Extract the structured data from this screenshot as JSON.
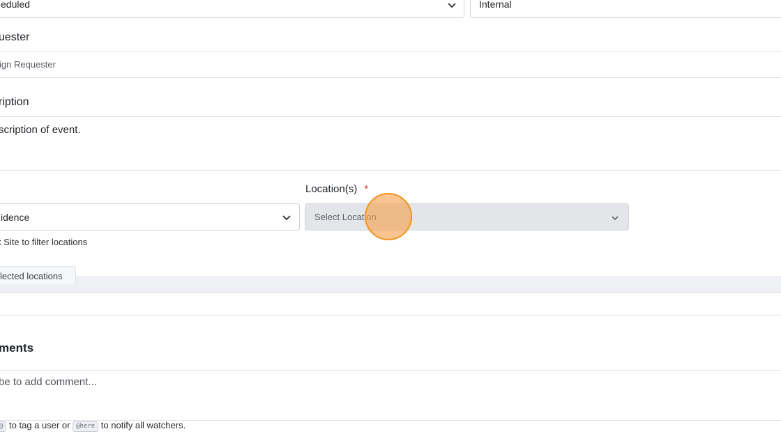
{
  "status_select": {
    "value": "eduled"
  },
  "type_select": {
    "value": "Internal"
  },
  "requester": {
    "label": "uester",
    "value": "ign Requester"
  },
  "description": {
    "label": "ription",
    "value": "scription of event."
  },
  "site_select": {
    "value": "idence",
    "helper": "t Site to filter locations"
  },
  "location": {
    "label": "Location(s)",
    "required_mark": "*",
    "placeholder": "Select Location"
  },
  "selected_locations": {
    "tab_label": "lected locations"
  },
  "comments": {
    "heading": "ments",
    "placeholder": "be to add comment...",
    "hint_chip_1": "@",
    "hint_text_1": " to tag a user or ",
    "hint_chip_2": "@here",
    "hint_text_2": " to notify all watchers."
  },
  "colors": {
    "required": "#d93a1a",
    "cursor_fill": "#f5a04a",
    "cursor_border": "#f0941f"
  }
}
